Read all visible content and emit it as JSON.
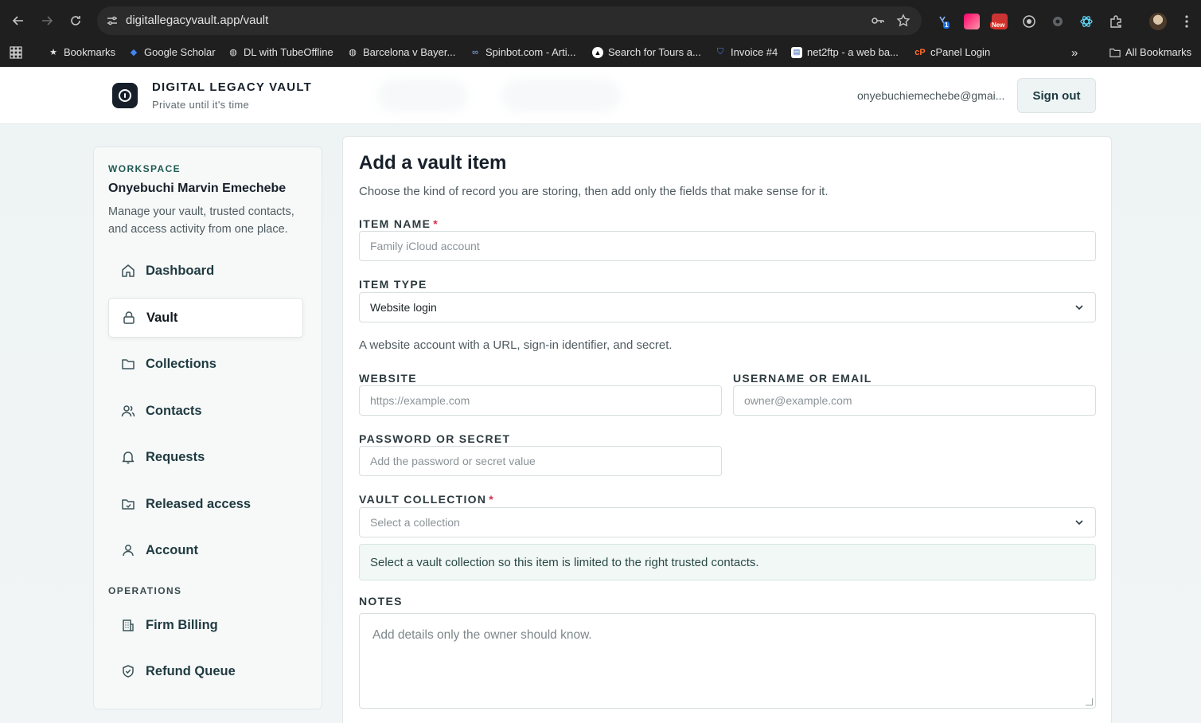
{
  "browser": {
    "url": "digitallegacyvault.app/vault",
    "bookmarks": [
      {
        "label": "Bookmarks",
        "icon": "star-icon"
      },
      {
        "label": "Google Scholar",
        "icon": "scholar-icon"
      },
      {
        "label": "DL with TubeOffline",
        "icon": "globe-icon"
      },
      {
        "label": "Barcelona v Bayer...",
        "icon": "globe-icon"
      },
      {
        "label": "Spinbot.com - Arti...",
        "icon": "spinbot-icon"
      },
      {
        "label": "Search for Tours a...",
        "icon": "triangle-icon"
      },
      {
        "label": "Invoice #4",
        "icon": "shield-icon"
      },
      {
        "label": "net2ftp - a web ba...",
        "icon": "page-icon"
      },
      {
        "label": "cPanel Login",
        "icon": "cpanel-icon"
      }
    ],
    "all_bookmarks": "All Bookmarks",
    "extension_badges": {
      "count": "1",
      "new": "New"
    }
  },
  "header": {
    "brand_title": "DIGITAL LEGACY VAULT",
    "brand_subtitle": "Private until it's time",
    "user_email": "onyebuchiemechebe@gmai...",
    "sign_out": "Sign out"
  },
  "sidebar": {
    "workspace_label": "WORKSPACE",
    "workspace_name": "Onyebuchi Marvin Emechebe",
    "workspace_desc": "Manage your vault, trusted contacts, and access activity from one place.",
    "items": [
      {
        "label": "Dashboard",
        "icon": "home-icon",
        "active": false
      },
      {
        "label": "Vault",
        "icon": "lock-icon",
        "active": true
      },
      {
        "label": "Collections",
        "icon": "folder-icon",
        "active": false
      },
      {
        "label": "Contacts",
        "icon": "users-icon",
        "active": false
      },
      {
        "label": "Requests",
        "icon": "bell-icon",
        "active": false
      },
      {
        "label": "Released access",
        "icon": "folder-open-icon",
        "active": false
      },
      {
        "label": "Account",
        "icon": "user-icon",
        "active": false
      }
    ],
    "operations_label": "OPERATIONS",
    "ops_items": [
      {
        "label": "Firm Billing",
        "icon": "building-icon"
      },
      {
        "label": "Refund Queue",
        "icon": "shield-check-icon"
      }
    ]
  },
  "form": {
    "title": "Add a vault item",
    "subtitle": "Choose the kind of record you are storing, then add only the fields that make sense for it.",
    "item_name_label": "ITEM NAME",
    "item_name_placeholder": "Family iCloud account",
    "item_type_label": "ITEM TYPE",
    "item_type_value": "Website login",
    "item_type_help": "A website account with a URL, sign-in identifier, and secret.",
    "website_label": "WEBSITE",
    "website_placeholder": "https://example.com",
    "username_label": "USERNAME OR EMAIL",
    "username_placeholder": "owner@example.com",
    "password_label": "PASSWORD OR SECRET",
    "password_placeholder": "Add the password or secret value",
    "collection_label": "VAULT COLLECTION",
    "collection_placeholder": "Select a collection",
    "collection_notice": "Select a vault collection so this item is limited to the right trusted contacts.",
    "notes_label": "NOTES",
    "notes_placeholder": "Add details only the owner should know.",
    "required_mark": "*"
  },
  "colors": {
    "accent": "#1e5a52",
    "required": "#d4304c",
    "chrome_bg": "#1f1f1f"
  }
}
